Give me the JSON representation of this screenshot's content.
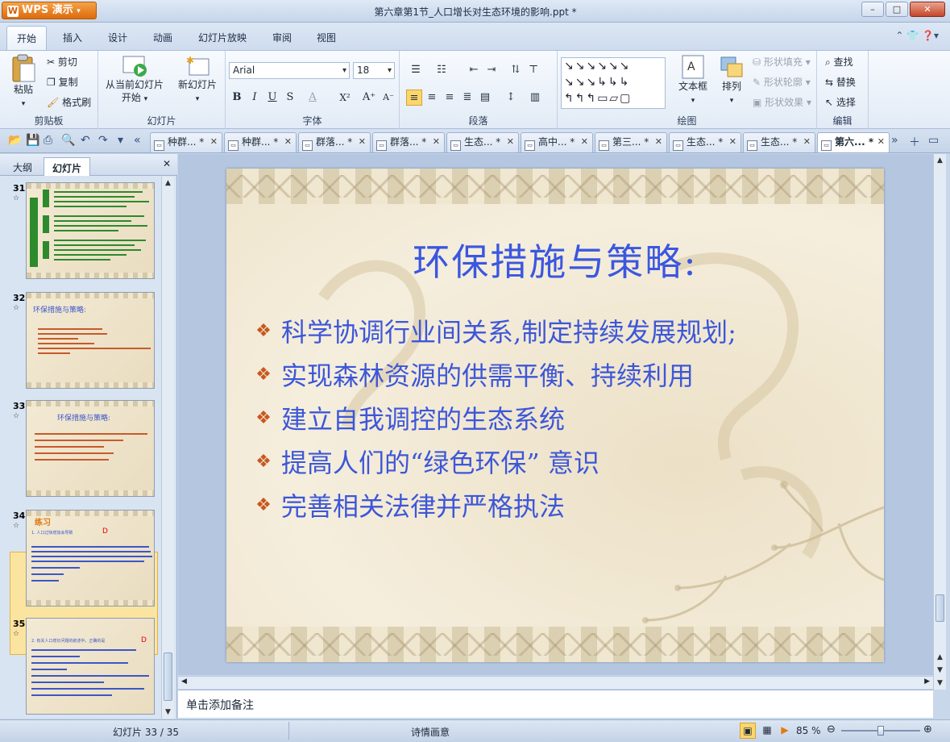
{
  "app": {
    "menu_button": "WPS 演示",
    "window_title": "第六章第1节_人口增长对生态环境的影响.ppt *",
    "window_controls": [
      "–",
      "□",
      "✕"
    ]
  },
  "menu_tabs": [
    "开始",
    "插入",
    "设计",
    "动画",
    "幻灯片放映",
    "审阅",
    "视图"
  ],
  "ribbon": {
    "clipboard": {
      "label": "剪贴板",
      "paste": "粘贴",
      "cut": "剪切",
      "copy": "复制",
      "format_painter": "格式刷"
    },
    "slides": {
      "label": "幻灯片",
      "from_current_1": "从当前幻灯片",
      "from_current_2": "开始",
      "new_slide": "新幻灯片"
    },
    "font": {
      "label": "字体",
      "font_name": "Arial",
      "font_size": "18"
    },
    "paragraph": {
      "label": "段落"
    },
    "drawing": {
      "label": "绘图",
      "textbox": "文本框",
      "arrange": "排列",
      "shape_fill": "形状填充",
      "shape_outline": "形状轮廓",
      "shape_effect": "形状效果"
    },
    "editing": {
      "label": "编辑",
      "find": "查找",
      "replace": "替换",
      "select": "选择"
    }
  },
  "doc_tabs": [
    {
      "label": "种群... *"
    },
    {
      "label": "种群... *"
    },
    {
      "label": "群落... *"
    },
    {
      "label": "群落... *"
    },
    {
      "label": "生态... *"
    },
    {
      "label": "高中... *"
    },
    {
      "label": "第三... *"
    },
    {
      "label": "生态... *"
    },
    {
      "label": "生态... *"
    },
    {
      "label": "第六... *"
    }
  ],
  "left_pane": {
    "tabs": [
      "大纲",
      "幻灯片"
    ],
    "thumbnails": [
      {
        "num": "31"
      },
      {
        "num": "32",
        "title": "环保措施与策略:"
      },
      {
        "num": "33",
        "title": "环保措施与策略:"
      },
      {
        "num": "34",
        "title": "练习",
        "text": "1. 人口过快增加会导致",
        "answer": "D"
      },
      {
        "num": "35",
        "text": "2. 有关人口增长问题的叙述中，正确的是",
        "answer": "D"
      }
    ]
  },
  "slide": {
    "title": "环保措施与策略:",
    "bullets": [
      "科学协调行业间关系,制定持续发展规划;",
      "实现森林资源的供需平衡、持续利用",
      "建立自我调控的生态系统",
      "提高人们的“绿色环保” 意识",
      "完善相关法律并严格执法"
    ]
  },
  "notes_placeholder": "单击添加备注",
  "status": {
    "slide_counter": "幻灯片 33 / 35",
    "theme": "诗情画意",
    "zoom": "85 %",
    "zoom_fraction": 0.5
  }
}
